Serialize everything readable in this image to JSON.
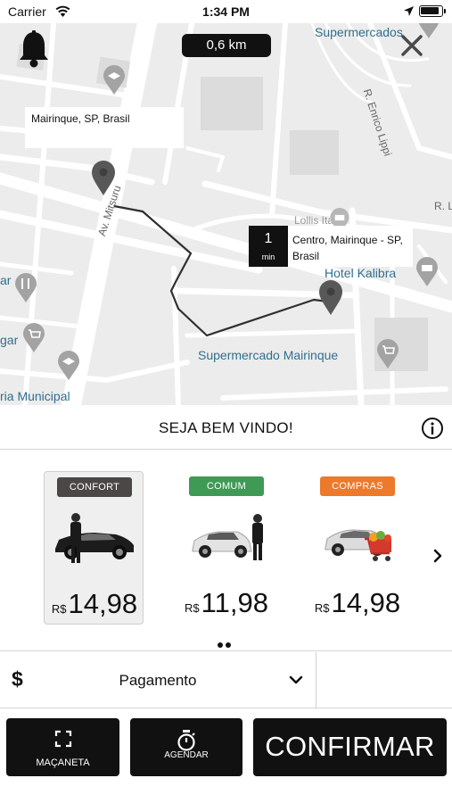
{
  "status": {
    "carrier": "Carrier",
    "time": "1:34 PM"
  },
  "map": {
    "distance": "0,6 km",
    "origin_label": "Mairinque, SP, Brasil",
    "destination": {
      "eta_value": "1",
      "eta_unit": "min",
      "label": "Centro, Mairinque - SP, Brasil"
    },
    "places": [
      "Supermercados",
      "R. Enrico Lippi",
      "Av. Mitsuru",
      "Lollis Ita",
      "R. L",
      "Hotel Kalibra",
      "Supermercado Mairinque",
      "ria Municipal",
      "ar",
      "gar"
    ]
  },
  "welcome": {
    "title": "SEJA BEM VINDO!"
  },
  "rides": [
    {
      "badge": "CONFORT",
      "badge_color": "#4a4746",
      "currency": "R$",
      "price": "14,98",
      "selected": true
    },
    {
      "badge": "COMUM",
      "badge_color": "#3f9a56",
      "currency": "R$",
      "price": "11,98",
      "selected": false
    },
    {
      "badge": "COMPRAS",
      "badge_color": "#ec7a2a",
      "currency": "R$",
      "price": "14,98",
      "selected": false
    }
  ],
  "payment": {
    "icon": "$",
    "label": "Pagamento"
  },
  "actions": {
    "macaneta": "MAÇANETA",
    "agendar": "AGENDAR",
    "confirmar": "CONFIRMAR"
  },
  "icons": {
    "bell": "bell-icon",
    "close": "close-icon",
    "info": "info-icon",
    "next": "chevron-right-icon",
    "payment_chevron": "chevron-down-icon",
    "macaneta": "expand-corners-icon",
    "agendar": "stopwatch-icon"
  }
}
